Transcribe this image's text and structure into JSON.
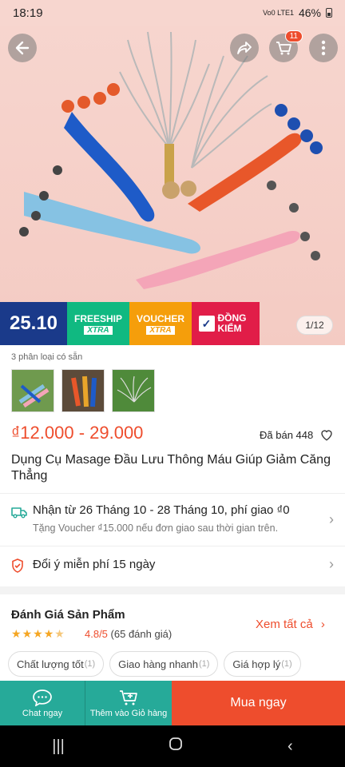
{
  "status_bar": {
    "time": "18:19",
    "network": "Vo0 LTE1",
    "battery": "46%"
  },
  "hero": {
    "image_counter": "1/12",
    "cart_count": "11"
  },
  "promo": {
    "date": "25.10",
    "freeship": "FREESHIP",
    "freeship_tag": "XTRA",
    "voucher": "VOUCHER",
    "voucher_tag": "XTRA",
    "dong_kiem": "ĐỒNG KIỂM"
  },
  "variants": {
    "label": "3 phân loại có sẵn"
  },
  "price": {
    "range": "₫12.000 - 29.000",
    "sold": "Đã bán 448"
  },
  "product": {
    "title": "Dụng Cụ Masage Đầu Lưu Thông Máu Giúp Giảm Căng Thẳng"
  },
  "shipping": {
    "main": "Nhận từ 26 Tháng 10 - 28 Tháng 10, phí giao ₫0",
    "sub": "Tặng Voucher ₫15.000 nếu đơn giao sau thời gian trên."
  },
  "returns": {
    "text": "Đổi ý miễn phí 15 ngày"
  },
  "reviews": {
    "title": "Đánh Giá Sản Phẩm",
    "rating": "4.8/5",
    "count": "(65 đánh giá)",
    "see_all": "Xem tất cả",
    "chips": [
      {
        "label": "Chất lượng tốt",
        "count": "(1)"
      },
      {
        "label": "Giao hàng nhanh",
        "count": "(1)"
      },
      {
        "label": "Giá hợp lý",
        "count": "(1)"
      }
    ]
  },
  "bottom_bar": {
    "chat": "Chat ngay",
    "add_cart": "Thêm vào Giỏ hàng",
    "buy": "Mua ngay"
  },
  "colors": {
    "accent": "#ee4d2d",
    "teal": "#26aa99",
    "hero_bg": "#f7d6cf"
  }
}
